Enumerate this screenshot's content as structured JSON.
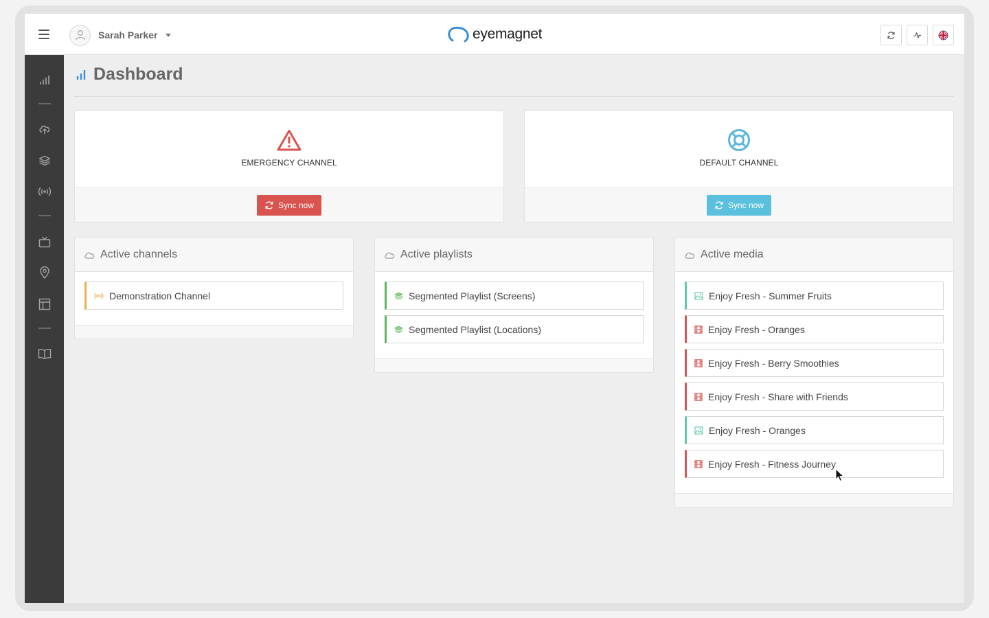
{
  "header": {
    "user_name": "Sarah Parker",
    "logo_text": "eyemagnet",
    "brand_color": "#3d8fd1",
    "buttons": [
      "refresh-icon",
      "activity-icon",
      "uk-flag-icon"
    ]
  },
  "sidebar": {
    "items": [
      {
        "icon": "bar-chart-icon"
      },
      {
        "icon": "cloud-upload-icon"
      },
      {
        "icon": "layers-icon"
      },
      {
        "icon": "broadcast-icon"
      },
      {
        "icon": "tv-icon"
      },
      {
        "icon": "map-pin-icon"
      },
      {
        "icon": "layout-icon"
      },
      {
        "icon": "book-icon"
      }
    ]
  },
  "page": {
    "title": "Dashboard"
  },
  "channels": {
    "emergency": {
      "label": "EMERGENCY CHANNEL",
      "button": "Sync now",
      "color": "#d9534f"
    },
    "default": {
      "label": "DEFAULT CHANNEL",
      "button": "Sync now",
      "color": "#5bc0de"
    }
  },
  "panels": {
    "active_channels": {
      "title": "Active channels",
      "items": [
        "Demonstration Channel"
      ]
    },
    "active_playlists": {
      "title": "Active playlists",
      "items": [
        "Segmented Playlist (Screens)",
        "Segmented Playlist (Locations)"
      ]
    },
    "active_media": {
      "title": "Active media",
      "items": [
        {
          "label": "Enjoy Fresh - Summer Fruits",
          "type": "image"
        },
        {
          "label": "Enjoy Fresh - Oranges",
          "type": "video"
        },
        {
          "label": "Enjoy Fresh - Berry Smoothies",
          "type": "video"
        },
        {
          "label": "Enjoy Fresh - Share with Friends",
          "type": "video"
        },
        {
          "label": "Enjoy Fresh - Oranges",
          "type": "image"
        },
        {
          "label": "Enjoy Fresh - Fitness Journey",
          "type": "video"
        }
      ]
    }
  }
}
